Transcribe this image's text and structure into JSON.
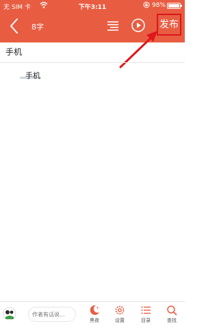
{
  "status_bar": {
    "carrier": "无 SIM 卡",
    "time": "下午3:11",
    "battery_percent": "98%",
    "battery_level": 0.98
  },
  "toolbar": {
    "word_count": "8字",
    "publish_label": "发布",
    "icons": [
      "back-icon",
      "outline-icon",
      "play-icon"
    ]
  },
  "document": {
    "title": "手机",
    "body": "手机"
  },
  "bottom_bar": {
    "comment_placeholder": "作者有话说...",
    "items": [
      {
        "label": "黑夜",
        "icon": "moon-icon"
      },
      {
        "label": "设置",
        "icon": "gear-icon"
      },
      {
        "label": "目录",
        "icon": "list-icon"
      },
      {
        "label": "查找",
        "icon": "search-icon"
      }
    ]
  },
  "colors": {
    "accent": "#e85d42",
    "highlight_border": "#d9161b"
  }
}
